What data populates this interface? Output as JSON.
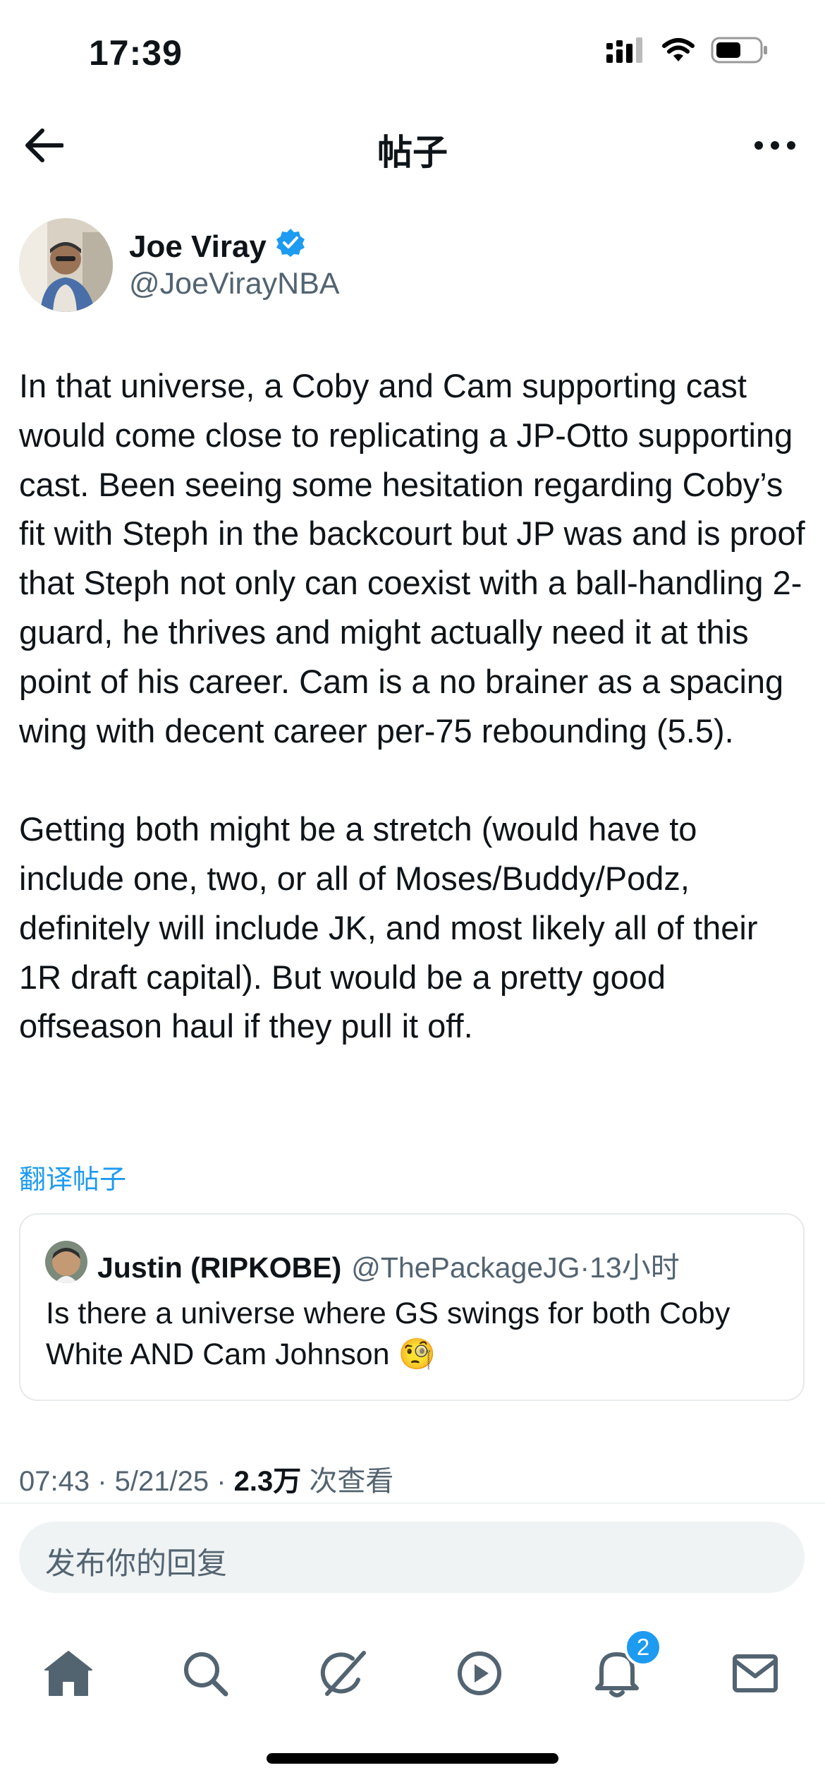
{
  "status_bar": {
    "time": "17:39"
  },
  "nav": {
    "title": "帖子"
  },
  "author": {
    "name": "Joe Viray",
    "handle": "@JoeVirayNBA"
  },
  "tweet": {
    "paragraphs": [
      "In that universe, a Coby and Cam supporting cast would come close to replicating a JP-Otto supporting cast. Been seeing some hesitation regarding Coby’s fit with Steph in the backcourt but JP was and is proof that Steph not only can coexist with a ball-handling 2-guard, he thrives and might actually need it at this point of his career. Cam is a no brainer as a spacing wing with decent career per-75 rebounding (5.5).",
      "Getting both might be a stretch (would have to include one, two, or all of Moses/Buddy/Podz, definitely will include JK, and most likely all of their 1R draft capital). But would be a pretty good offseason haul if they pull it off."
    ],
    "translate_label": "翻译帖子"
  },
  "quote": {
    "name": "Justin (RIPKOBE)",
    "handle": "@ThePackageJG",
    "time": "13小时",
    "text": "Is there a universe where GS swings for both Coby White AND Cam Johnson 🧐"
  },
  "meta": {
    "time": "07:43",
    "date": "5/21/25",
    "views": "2.3万",
    "views_label": "次查看"
  },
  "reply": {
    "placeholder": "发布你的回复"
  },
  "tabbar": {
    "notifications_badge": "2"
  },
  "colors": {
    "accent": "#1d9bf0",
    "text": "#0f1419",
    "secondary": "#536471"
  },
  "icons": [
    "back-arrow-icon",
    "more-icon",
    "verified-badge-icon",
    "home-icon",
    "search-icon",
    "grok-icon",
    "video-icon",
    "bell-icon",
    "mail-icon",
    "signal-icon",
    "wifi-icon",
    "battery-icon"
  ]
}
